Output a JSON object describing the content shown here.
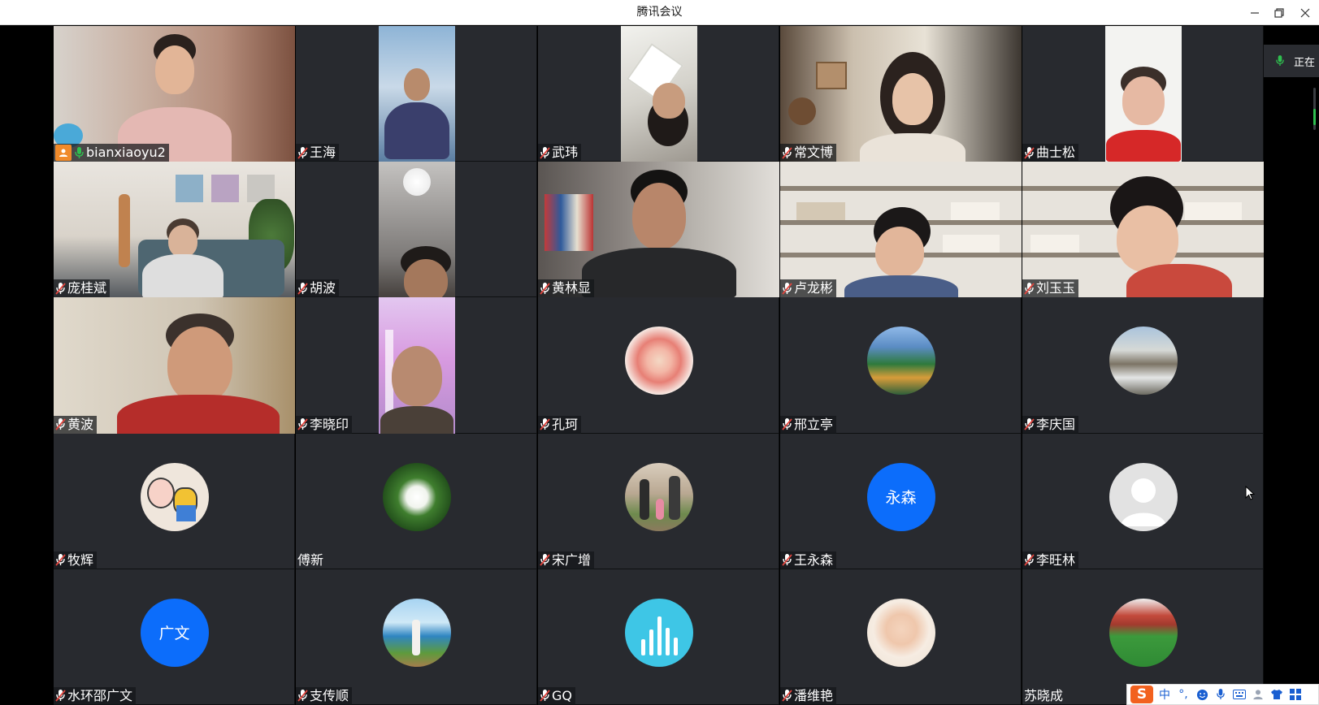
{
  "window": {
    "title": "腾讯会议"
  },
  "side_panel": {
    "speaking_label": "正在"
  },
  "ime": {
    "logo": "S",
    "mode": "中",
    "punct": "°,"
  },
  "colors": {
    "accent_blue": "#0c6dfb",
    "mic_green": "#2fbf4f",
    "active_border": "#35c24a",
    "tile_bg": "#282a2f",
    "muted_red": "#e0453e"
  },
  "participants": [
    {
      "name": "bianxiaoyu2",
      "mic": "active",
      "host_icon": "user-icon",
      "type": "video",
      "scene": "pink-office"
    },
    {
      "name": "王海",
      "mic": "muted",
      "type": "video",
      "scene": "outdoor-sky"
    },
    {
      "name": "武玮",
      "mic": "muted",
      "type": "video",
      "scene": "ceiling-light"
    },
    {
      "name": "常文博",
      "mic": "muted",
      "type": "video",
      "scene": "living-room"
    },
    {
      "name": "曲士松",
      "mic": "muted",
      "type": "video",
      "scene": "white-wall"
    },
    {
      "name": "庞桂斌",
      "mic": "muted",
      "type": "video",
      "scene": "family-room"
    },
    {
      "name": "胡波",
      "mic": "muted",
      "type": "video",
      "scene": "ceiling-lamp"
    },
    {
      "name": "黄林显",
      "mic": "muted",
      "type": "video",
      "scene": "bedroom-clothes"
    },
    {
      "name": "卢龙彬",
      "mic": "muted",
      "type": "video",
      "scene": "bookshelf"
    },
    {
      "name": "刘玉玉",
      "mic": "muted",
      "type": "video",
      "scene": "bookshelf"
    },
    {
      "name": "黄波",
      "mic": "muted",
      "type": "video",
      "scene": "home-wall"
    },
    {
      "name": "李晓印",
      "mic": "muted",
      "type": "video",
      "scene": "purple-light"
    },
    {
      "name": "孔珂",
      "mic": "muted",
      "type": "avatar",
      "avatar": "flower-photo"
    },
    {
      "name": "邢立亭",
      "mic": "muted",
      "type": "avatar",
      "avatar": "city-photo"
    },
    {
      "name": "李庆国",
      "mic": "muted",
      "type": "avatar",
      "avatar": "snow-photo"
    },
    {
      "name": "牧辉",
      "mic": "muted",
      "type": "avatar",
      "avatar": "cartoon-photo"
    },
    {
      "name": "傅新",
      "mic": "none",
      "type": "avatar",
      "avatar": "lotus-photo"
    },
    {
      "name": "宋广增",
      "mic": "muted",
      "type": "avatar",
      "avatar": "family-walk-photo"
    },
    {
      "name": "王永森",
      "mic": "muted",
      "type": "avatar",
      "avatar_text": "永森"
    },
    {
      "name": "李旺林",
      "mic": "muted",
      "type": "avatar",
      "avatar": "default-user"
    },
    {
      "name": "水环邵广文",
      "mic": "muted",
      "type": "avatar",
      "avatar_text": "广文"
    },
    {
      "name": "支传顺",
      "mic": "muted",
      "type": "avatar",
      "avatar": "lake-photo"
    },
    {
      "name": "GQ",
      "mic": "muted",
      "type": "avatar",
      "avatar": "audio-bars"
    },
    {
      "name": "潘维艳",
      "mic": "muted",
      "type": "avatar",
      "avatar": "baby-photo"
    },
    {
      "name": "苏晓成",
      "mic": "none",
      "type": "avatar",
      "avatar": "field-photo"
    }
  ]
}
